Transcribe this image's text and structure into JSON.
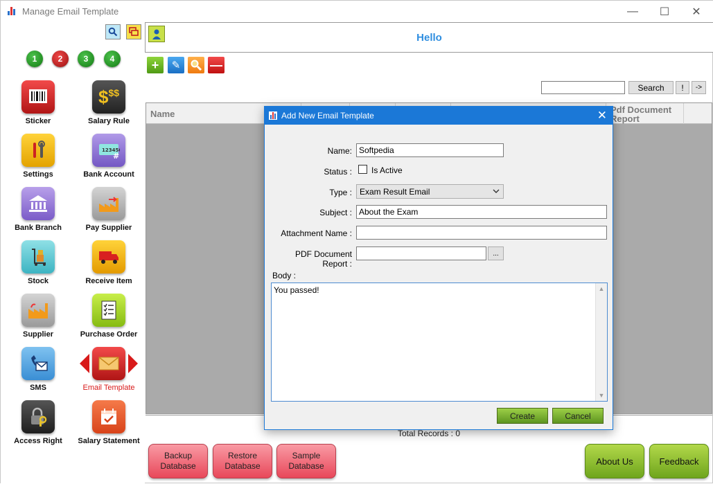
{
  "window": {
    "title": "Manage Email Template",
    "minimize": "—",
    "maximize": "☐",
    "close": "✕"
  },
  "left": {
    "steps": [
      "1",
      "2",
      "3",
      "4"
    ],
    "tiles": [
      {
        "label": "Sticker",
        "icon": "barcode-icon"
      },
      {
        "label": "Salary Rule",
        "icon": "money-bag-icon"
      },
      {
        "label": "Settings",
        "icon": "tools-icon"
      },
      {
        "label": "Bank Account",
        "icon": "card-icon"
      },
      {
        "label": "Bank Branch",
        "icon": "bank-icon"
      },
      {
        "label": "Pay Supplier",
        "icon": "factory-pay-icon"
      },
      {
        "label": "Stock",
        "icon": "trolley-icon"
      },
      {
        "label": "Receive Item",
        "icon": "truck-icon"
      },
      {
        "label": "Supplier",
        "icon": "factory-icon"
      },
      {
        "label": "Purchase Order",
        "icon": "checklist-icon"
      },
      {
        "label": "SMS",
        "icon": "phone-mail-icon"
      },
      {
        "label": "Email Template",
        "icon": "envelope-icon"
      },
      {
        "label": "Access Right",
        "icon": "lock-key-icon"
      },
      {
        "label": "Salary Statement",
        "icon": "calendar-check-icon"
      }
    ]
  },
  "header": {
    "greeting": "Hello"
  },
  "toolbar": {
    "add": "+",
    "edit": "✎",
    "search": "⚲",
    "delete": "—"
  },
  "search": {
    "value": "",
    "button": "Search",
    "bang": "!",
    "arrow": "->"
  },
  "grid": {
    "columns": [
      "Name",
      "",
      "",
      "",
      "",
      "Pdf Document Report"
    ],
    "total": "Total Records : 0"
  },
  "bottom": {
    "backup": "Backup Database",
    "restore": "Restore Database",
    "sample": "Sample Database",
    "about": "About Us",
    "feedback": "Feedback"
  },
  "dialog": {
    "title": "Add New Email Template",
    "name_label": "Name:",
    "name_value": "Softpedia",
    "status_label": "Status :",
    "is_active": "Is Active",
    "type_label": "Type :",
    "type_value": "Exam Result Email",
    "subject_label": "Subject :",
    "subject_value": "About the Exam",
    "attachment_label": "Attachment Name :",
    "attachment_value": "",
    "pdf_label": "PDF Document Report :",
    "pdf_value": "",
    "browse": "...",
    "body_label": "Body :",
    "body_value": "You passed!",
    "create": "Create",
    "cancel": "Cancel"
  },
  "colors": {
    "accent": "#1b78d7",
    "hello": "#2f8ee0",
    "green": "#6fa51d",
    "pink": "#e8485a"
  }
}
